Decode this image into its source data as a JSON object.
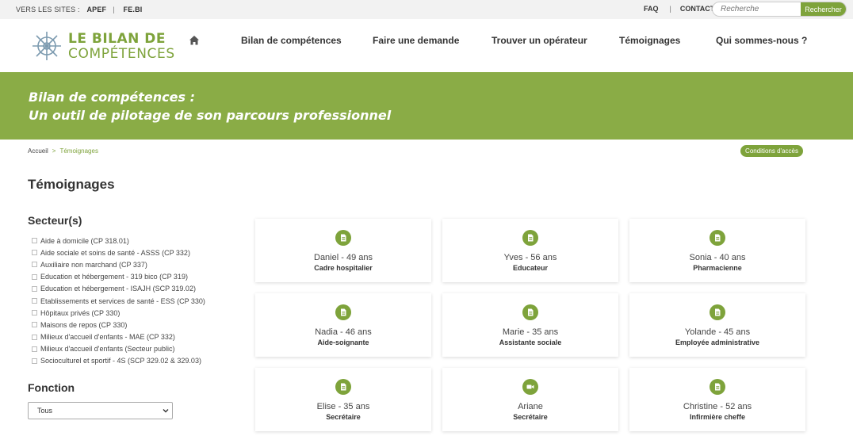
{
  "topbar": {
    "sites_label": "VERS LES SITES :",
    "site_links": [
      "APEF",
      "FE.BI"
    ],
    "faq": "FAQ",
    "contact": "CONTACT",
    "search_placeholder": "Recherche",
    "search_button": "Rechercher"
  },
  "logo": {
    "line1": "LE BILAN DE",
    "line2": "COMPÉTENCES"
  },
  "nav": {
    "home_icon": "home-icon",
    "items": [
      "Bilan de compétences",
      "Faire une demande",
      "Trouver un opérateur",
      "Témoignages",
      "Qui sommes-nous ?"
    ]
  },
  "banner": {
    "line1": "Bilan de compétences :",
    "line2": "Un outil de pilotage de son parcours professionnel"
  },
  "breadcrumb": {
    "home": "Accueil",
    "separator": ">",
    "current": "Témoignages"
  },
  "conditions_button": "Conditions d'accès",
  "page_title": "Témoignages",
  "secteurs": {
    "title": "Secteur(s)",
    "items": [
      "Aide à domicile (CP 318.01)",
      "Aide sociale et soins de santé - ASSS (CP 332)",
      "Auxiliaire non marchand (CP 337)",
      "Education et hébergement - 319 bico (CP 319)",
      "Education et hébergement - ISAJH (SCP 319.02)",
      "Etablissements et services de santé - ESS (CP 330)",
      "Hôpitaux privés (CP 330)",
      "Maisons de repos (CP 330)",
      "Milieux d'accueil d'enfants - MAE (CP 332)",
      "Milieux d'accueil d'enfants (Secteur public)",
      "Socioculturel et sportif - 4S (SCP 329.02 & 329.03)"
    ]
  },
  "fonction": {
    "title": "Fonction",
    "selected": "Tous"
  },
  "colors": {
    "accent": "#7ea33b",
    "banner": "#8aac46"
  },
  "testimonials": [
    {
      "name": "Daniel - 49 ans",
      "job": "Cadre hospitalier",
      "icon": "document-icon"
    },
    {
      "name": "Yves - 56 ans",
      "job": "Educateur",
      "icon": "document-icon"
    },
    {
      "name": "Sonia - 40 ans",
      "job": "Pharmacienne",
      "icon": "document-icon"
    },
    {
      "name": "Nadia - 46 ans",
      "job": "Aide-soignante",
      "icon": "document-icon"
    },
    {
      "name": "Marie - 35 ans",
      "job": "Assistante sociale",
      "icon": "document-icon"
    },
    {
      "name": "Yolande - 45 ans",
      "job": "Employée administrative",
      "icon": "document-icon"
    },
    {
      "name": "Elise - 35 ans",
      "job": "Secrétaire",
      "icon": "document-icon"
    },
    {
      "name": "Ariane",
      "job": "Secrétaire",
      "icon": "video-icon"
    },
    {
      "name": "Christine - 52 ans",
      "job": "Infirmière cheffe",
      "icon": "document-icon"
    }
  ]
}
